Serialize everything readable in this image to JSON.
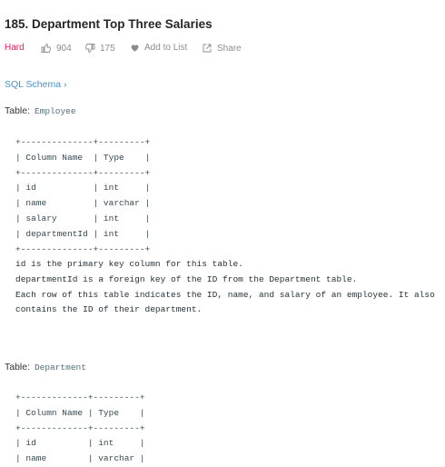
{
  "problem": {
    "title": "185. Department Top Three Salaries",
    "difficulty": "Hard",
    "likes": "904",
    "dislikes": "175",
    "add_to_list": "Add to List",
    "share": "Share",
    "sql_schema_link": "SQL Schema ›"
  },
  "colors": {
    "difficulty_hard": "#e91e63",
    "link": "#4a90c8",
    "muted": "#8c8c8c"
  },
  "icons": [
    "thumbs-up-icon",
    "thumbs-down-icon",
    "heart-icon",
    "share-icon"
  ],
  "employee": {
    "label": "Table:",
    "name": "Employee",
    "schema_table": "+--------------+---------+\n| Column Name  | Type    |\n+--------------+---------+\n| id           | int     |\n| name         | varchar |\n| salary       | int     |\n| departmentId | int     |\n+--------------+---------+",
    "description": "id is the primary key column for this table.\ndepartmentId is a foreign key of the ID from the Department table.\nEach row of this table indicates the ID, name, and salary of an employee. It also\ncontains the ID of their department."
  },
  "department": {
    "label": "Table:",
    "name": "Department",
    "schema_table": "+-------------+---------+\n| Column Name | Type    |\n+-------------+---------+\n| id          | int     |\n| name        | varchar |"
  }
}
